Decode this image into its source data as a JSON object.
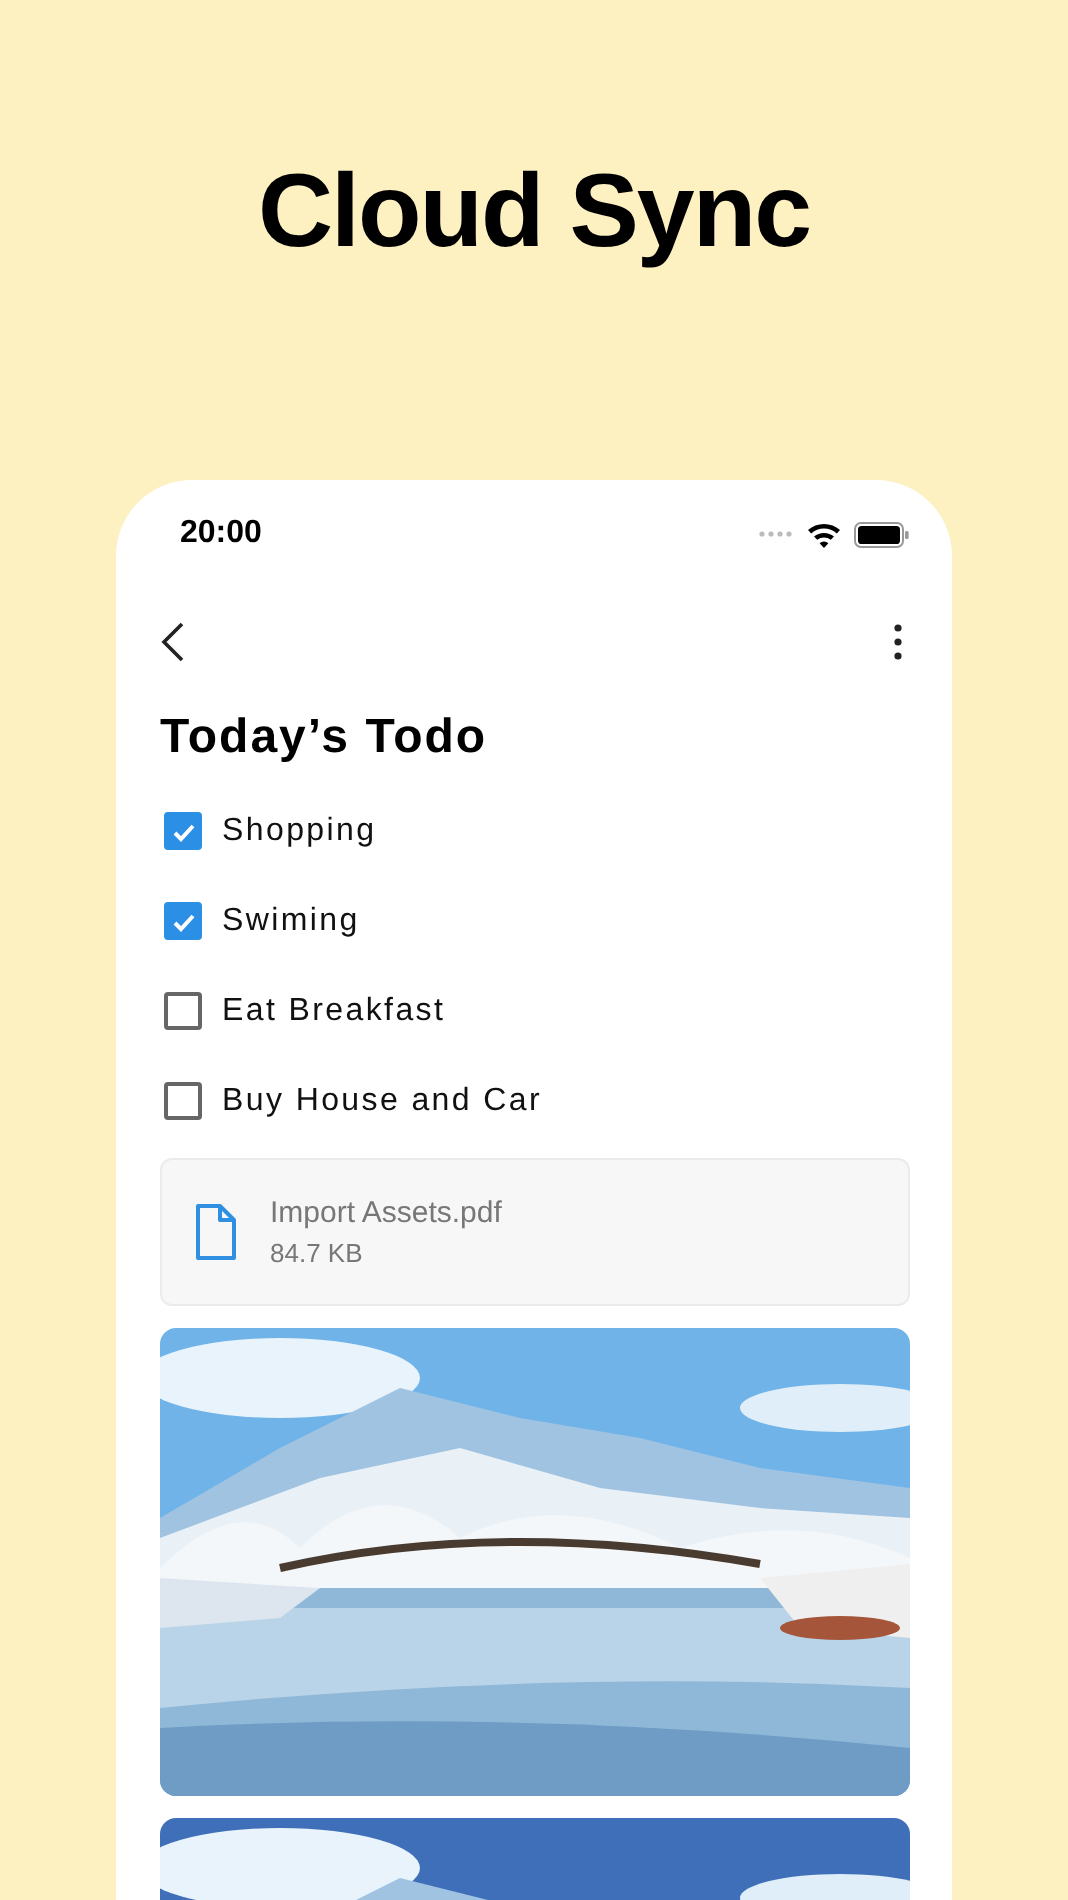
{
  "headline": "Cloud Sync",
  "status_bar": {
    "time": "20:00"
  },
  "note": {
    "title": "Today’s Todo",
    "todos": [
      {
        "label": "Shopping",
        "checked": true
      },
      {
        "label": "Swiming",
        "checked": true
      },
      {
        "label": "Eat Breakfast",
        "checked": false
      },
      {
        "label": "Buy House and Car",
        "checked": false
      }
    ],
    "attachment": {
      "name": "Import Assets.pdf",
      "size": "84.7 KB"
    }
  }
}
